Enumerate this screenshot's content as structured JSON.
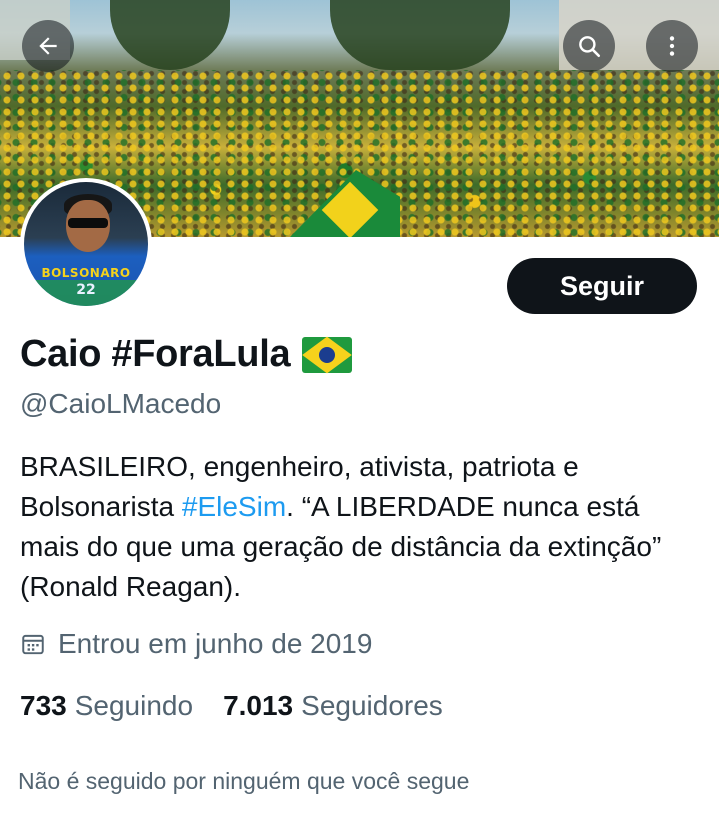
{
  "header": {
    "back_icon": "arrow-left-icon",
    "search_icon": "search-icon",
    "more_icon": "more-vertical-icon"
  },
  "profile": {
    "display_name": "Caio #ForaLula",
    "name_emoji": "flag-brazil",
    "handle": "@CaioLMacedo",
    "follow_label": "Seguir",
    "avatar_shirt_text": "BOLSONARO",
    "avatar_shirt_number": "22",
    "bio": {
      "part1": "BRASILEIRO, engenheiro, ativista, patriota e Bolsonarista ",
      "hashtag": "#EleSim",
      "part2": ". “A LIBERDADE nunca está mais do que uma geração de distância da extinção” (Ronald Reagan)."
    },
    "joined": "Entrou em junho de 2019",
    "following_count": "733",
    "following_label": "Seguindo",
    "followers_count": "7.013",
    "followers_label": "Seguidores",
    "not_followed_text": "Não é seguido por ninguém que você segue"
  },
  "colors": {
    "text_primary": "#0f1419",
    "text_secondary": "#536471",
    "link": "#1d9bf0",
    "button_bg": "#0f1419"
  }
}
